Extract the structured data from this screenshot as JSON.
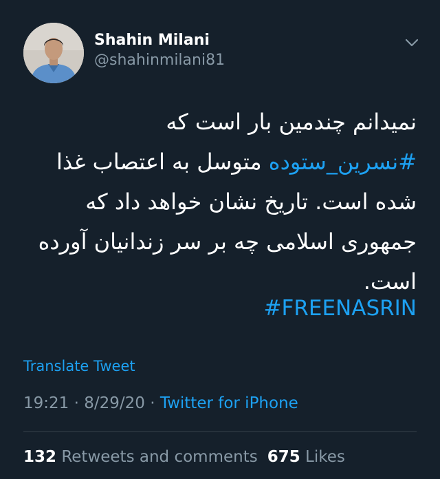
{
  "tweet": {
    "author": {
      "display_name": "Shahin Milani",
      "handle": "@shahinmilani81"
    },
    "body": {
      "line1": "نمیدانم چندمین بار است که",
      "hashtag_fa": "#نسرین_ستوده",
      "line2_rest": " متوسل به اعتصاب غذا",
      "line3": "شده است. تاریخ نشان خواهد داد که",
      "line4": "جمهوری اسلامی چه بر سر زندانیان آورده",
      "line5": "است.",
      "hashtag_en": "#FREENASRIN"
    },
    "translate_label": "Translate Tweet",
    "time": "19:21",
    "separator": " · ",
    "date": "8/29/20",
    "source": "Twitter for iPhone",
    "stats": {
      "retweets_count": "132",
      "retweets_label": "Retweets and comments",
      "likes_count": "675",
      "likes_label": "Likes"
    }
  },
  "icons": {
    "caret": "chevron-down-icon",
    "avatar": "profile-photo"
  },
  "colors": {
    "background": "#15202b",
    "link": "#1da1f2",
    "secondary_text": "#8899a6",
    "divider": "#38444d"
  }
}
